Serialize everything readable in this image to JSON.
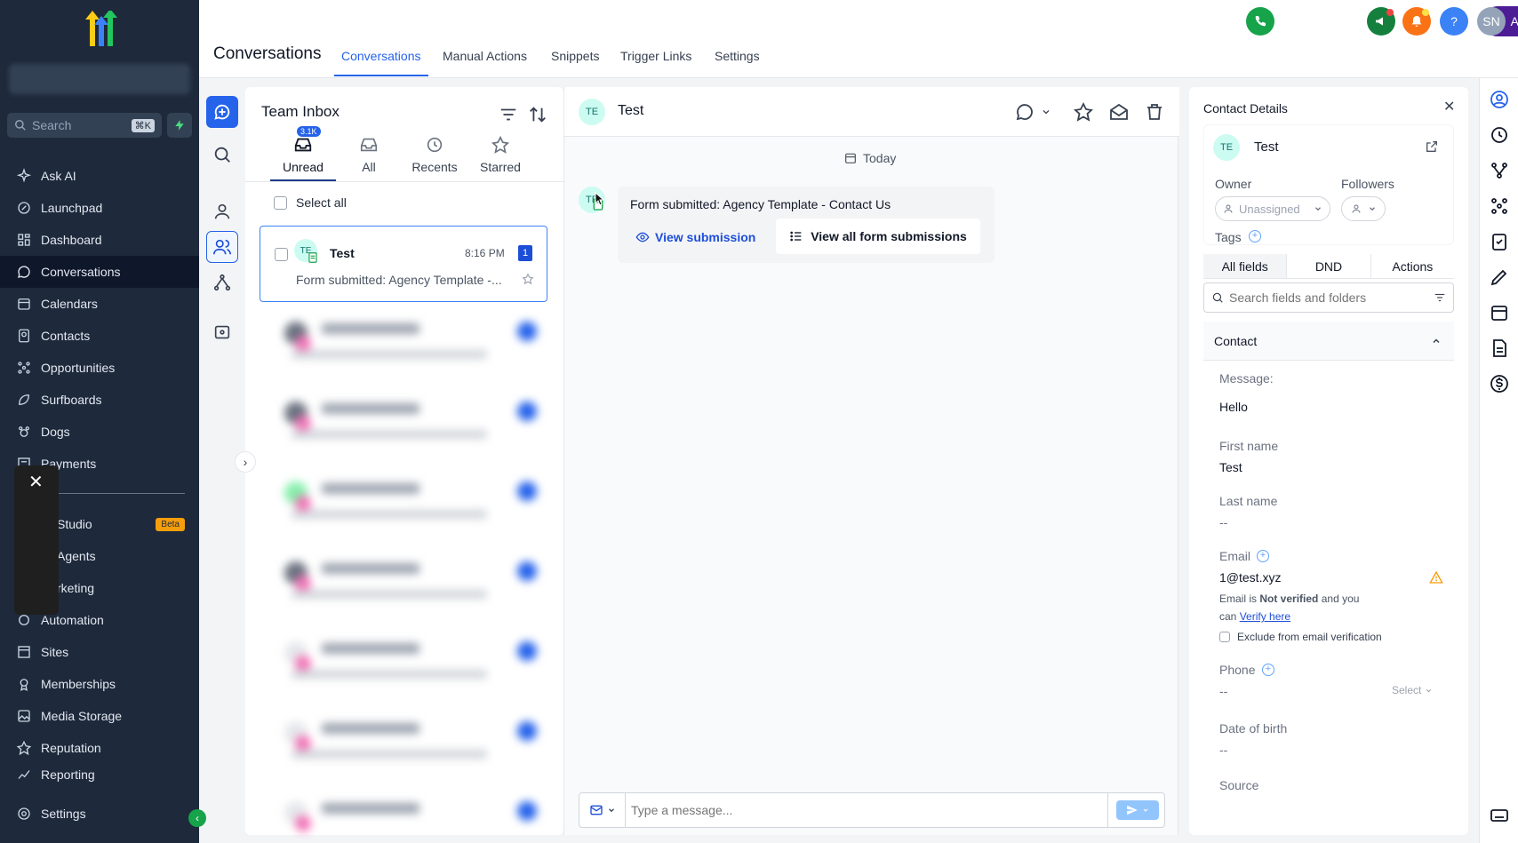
{
  "sidebar": {
    "search_placeholder": "Search",
    "search_shortcut": "⌘K",
    "items": [
      {
        "label": "Ask AI",
        "icon": "sparkle-icon"
      },
      {
        "label": "Launchpad",
        "icon": "rocket-icon"
      },
      {
        "label": "Dashboard",
        "icon": "grid-icon"
      },
      {
        "label": "Conversations",
        "icon": "chat-icon",
        "active": true
      },
      {
        "label": "Calendars",
        "icon": "calendar-icon"
      },
      {
        "label": "Contacts",
        "icon": "contacts-icon"
      },
      {
        "label": "Opportunities",
        "icon": "opportunities-icon"
      },
      {
        "label": "Surfboards",
        "icon": "surfboard-icon"
      },
      {
        "label": "Dogs",
        "icon": "dog-icon"
      },
      {
        "label": "Payments",
        "icon": "payments-icon"
      },
      {
        "label": "Studio",
        "icon": "studio-icon",
        "badge": "Beta"
      },
      {
        "label": "Agents",
        "icon": "agents-icon"
      },
      {
        "label": "rketing",
        "icon": "marketing-icon"
      },
      {
        "label": "Automation",
        "icon": "automation-icon"
      },
      {
        "label": "Sites",
        "icon": "sites-icon"
      },
      {
        "label": "Memberships",
        "icon": "memberships-icon"
      },
      {
        "label": "Media Storage",
        "icon": "media-icon"
      },
      {
        "label": "Reputation",
        "icon": "star-icon"
      },
      {
        "label": "Reporting",
        "icon": "reporting-icon"
      }
    ],
    "studio_label": "Studio",
    "studio_badge": "Beta",
    "agents_label": "Agents",
    "marketing_label": "rketing",
    "settings_label": "Settings"
  },
  "header": {
    "title": "Conversations",
    "tabs": [
      "Conversations",
      "Manual Actions",
      "Snippets",
      "Trigger Links",
      "Settings"
    ],
    "active_tab": "Conversations",
    "ask_ai_label": "Ask AI",
    "help_label": "?",
    "user_initials": "SN"
  },
  "inbox": {
    "title": "Team Inbox",
    "tabs": [
      {
        "label": "Unread",
        "badge": "3.1K"
      },
      {
        "label": "All"
      },
      {
        "label": "Recents"
      },
      {
        "label": "Starred"
      }
    ],
    "select_all_label": "Select all",
    "conversation": {
      "initials": "TE",
      "name": "Test",
      "time": "8:16 PM",
      "unread_count": "1",
      "preview": "Form submitted: Agency Template -..."
    }
  },
  "chat": {
    "contact_initials": "TE",
    "contact_name": "Test",
    "date_divider": "Today",
    "message_text": "Form submitted: Agency Template - Contact Us",
    "view_submission_label": "View submission",
    "view_all_label": "View all form submissions",
    "composer_placeholder": "Type a message..."
  },
  "details": {
    "title": "Contact Details",
    "initials": "TE",
    "name": "Test",
    "owner_label": "Owner",
    "owner_value": "Unassigned",
    "followers_label": "Followers",
    "tags_label": "Tags",
    "tabs": [
      "All fields",
      "DND",
      "Actions"
    ],
    "search_placeholder": "Search fields and folders",
    "section_title": "Contact",
    "message_label": "Message:",
    "message_value": "Hello",
    "first_name_label": "First name",
    "first_name_value": "Test",
    "last_name_label": "Last name",
    "last_name_value": "--",
    "email_label": "Email",
    "email_value": "1@test.xyz",
    "email_note_1": "Email is",
    "email_note_bold": "Not verified",
    "email_note_2": "and you",
    "email_note_3": "can",
    "verify_link": "Verify here",
    "exclude_label": "Exclude from email verification",
    "phone_label": "Phone",
    "phone_value": "--",
    "phone_select": "Select",
    "dob_label": "Date of birth",
    "dob_value": "--",
    "source_label": "Source"
  }
}
